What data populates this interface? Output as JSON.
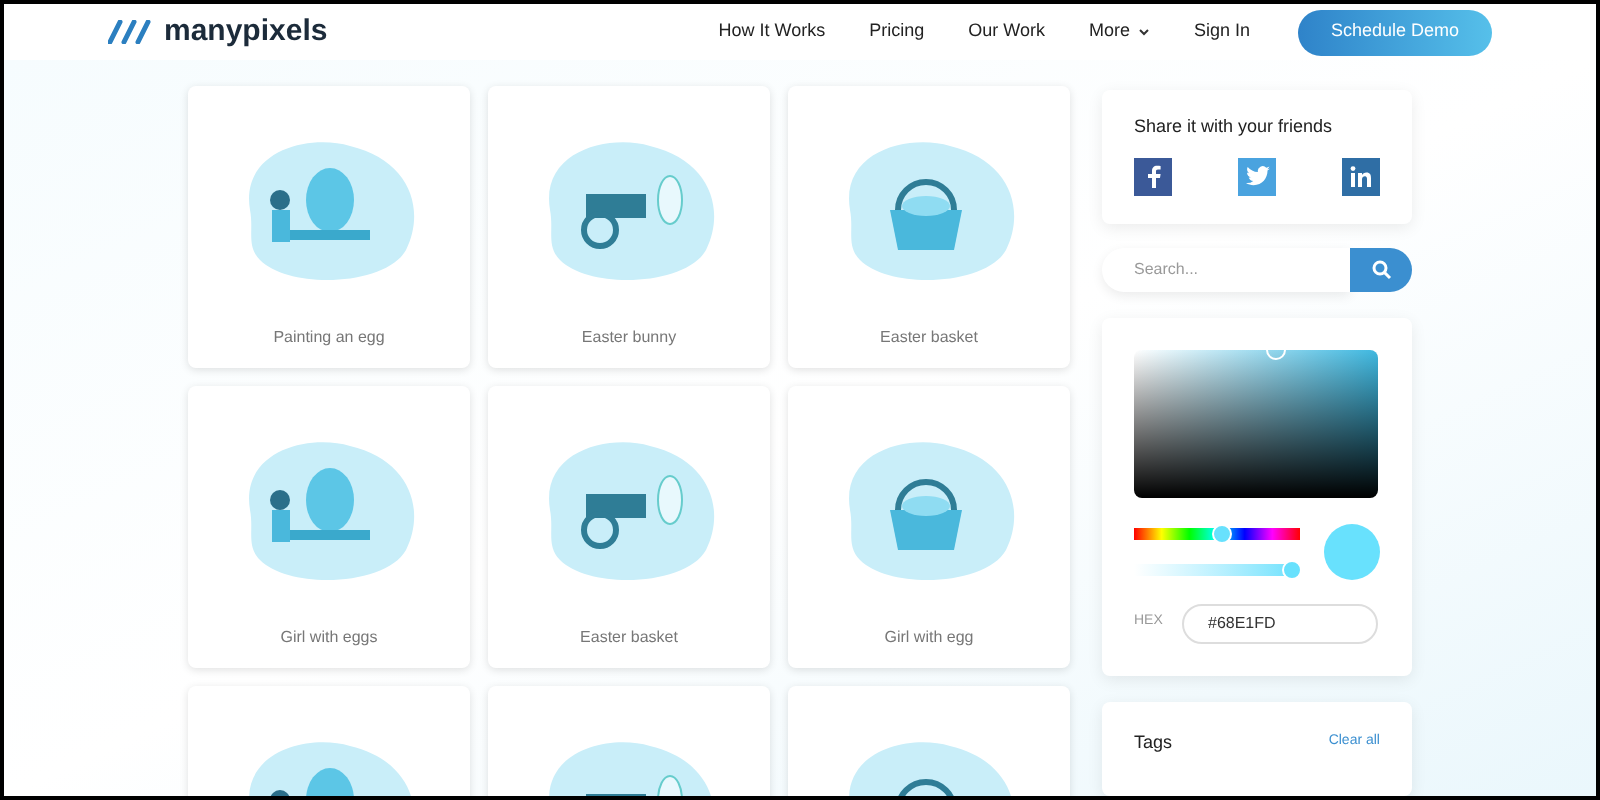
{
  "header": {
    "logo": "manypixels",
    "nav": [
      {
        "label": "How It Works",
        "kind": "link"
      },
      {
        "label": "Pricing",
        "kind": "link"
      },
      {
        "label": "Our Work",
        "kind": "link"
      },
      {
        "label": "More",
        "kind": "dropdown"
      },
      {
        "label": "Sign In",
        "kind": "link"
      }
    ],
    "cta": "Schedule Demo"
  },
  "gallery": [
    {
      "kind": "full",
      "label": "Painting an egg"
    },
    {
      "kind": "full",
      "label": "Easter bunny"
    },
    {
      "kind": "full",
      "label": "Easter basket"
    },
    {
      "kind": "full",
      "label": "Girl with eggs"
    },
    {
      "kind": "full",
      "label": "Easter basket"
    },
    {
      "kind": "full",
      "label": "Girl with egg"
    },
    {
      "kind": "cropped"
    },
    {
      "kind": "cropped"
    },
    {
      "kind": "cropped"
    }
  ],
  "share": {
    "title": "Share it with your friends",
    "networks": [
      {
        "kind": "facebook",
        "color": "#3b5998"
      },
      {
        "kind": "twitter",
        "color": "#4aa3df"
      },
      {
        "kind": "linkedin",
        "color": "#2f6ea5"
      }
    ]
  },
  "search": {
    "placeholder": "Search..."
  },
  "color_picker": {
    "hue": {
      "level": 0.53
    },
    "opacity": {
      "level": 0.95
    },
    "hex_label": "HEX",
    "hex_value": "#68E1FD"
  },
  "tags": {
    "title": "Tags",
    "clear": "Clear all"
  }
}
